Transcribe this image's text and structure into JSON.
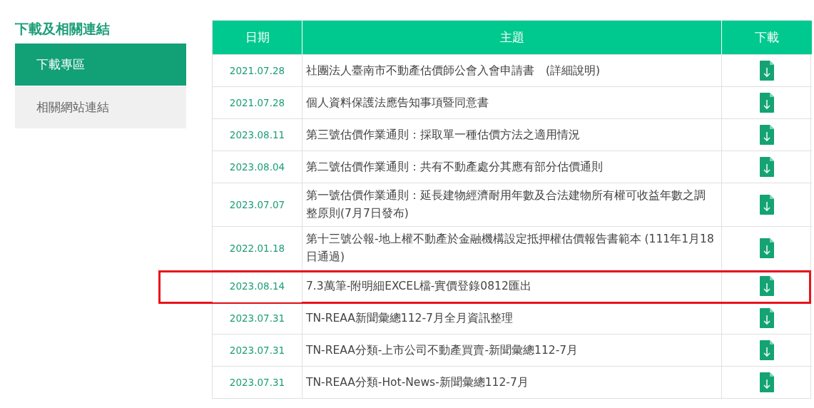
{
  "sidebar": {
    "heading": "下載及相關連結",
    "items": [
      {
        "label": "下載專區",
        "selected": true
      },
      {
        "label": "相關網站連結",
        "selected": false
      }
    ]
  },
  "table": {
    "columns": [
      "日期",
      "主題",
      "下載"
    ],
    "rows": [
      {
        "date": "2021.07.28",
        "subject": "社團法人臺南市不動產估價師公會入會申請書　(詳細說明)",
        "highlighted": false
      },
      {
        "date": "2021.07.28",
        "subject": "個人資料保護法應告知事項暨同意書",
        "highlighted": false
      },
      {
        "date": "2023.08.11",
        "subject": "第三號估價作業通則：採取單一種估價方法之適用情況",
        "highlighted": false
      },
      {
        "date": "2023.08.04",
        "subject": "第二號估價作業通則：共有不動產處分其應有部分估價通則",
        "highlighted": false
      },
      {
        "date": "2023.07.07",
        "subject": "第一號估價作業通則：延長建物經濟耐用年數及合法建物所有權可收益年數之調整原則(7月7日發布)",
        "highlighted": false
      },
      {
        "date": "2022.01.18",
        "subject": "第十三號公報-地上權不動產於金融機構設定抵押權估價報告書範本 (111年1月18日通過)",
        "highlighted": false
      },
      {
        "date": "2023.08.14",
        "subject": "7.3萬筆-附明細EXCEL檔-實價登錄0812匯出",
        "highlighted": true
      },
      {
        "date": "2023.07.31",
        "subject": "TN-REAA新聞彙總112-7月全月資訊整理",
        "highlighted": false
      },
      {
        "date": "2023.07.31",
        "subject": "TN-REAA分類-上市公司不動產買賣-新聞彙總112-7月",
        "highlighted": false
      },
      {
        "date": "2023.07.31",
        "subject": "TN-REAA分類-Hot-News-新聞彙總112-7月",
        "highlighted": false
      }
    ]
  }
}
